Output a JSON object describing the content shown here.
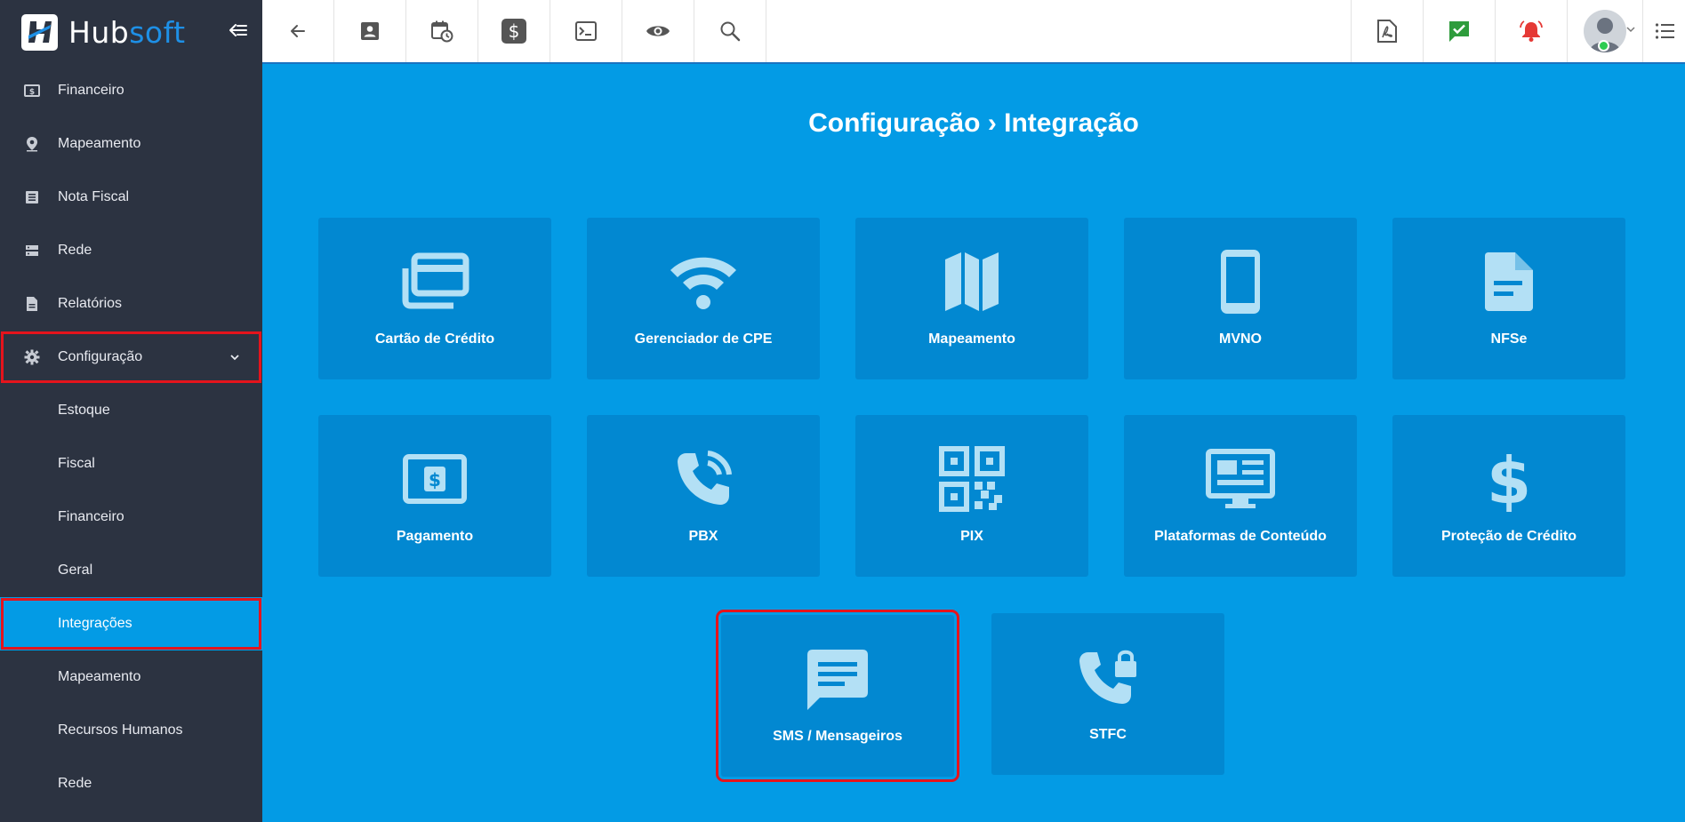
{
  "app": {
    "brand_prefix": "Hub",
    "brand_suffix": "soft"
  },
  "sidebar": {
    "items": [
      {
        "label": "Financeiro",
        "icon": "money-icon"
      },
      {
        "label": "Mapeamento",
        "icon": "map-pin-icon"
      },
      {
        "label": "Nota Fiscal",
        "icon": "receipt-icon"
      },
      {
        "label": "Rede",
        "icon": "server-icon"
      },
      {
        "label": "Relatórios",
        "icon": "document-icon"
      },
      {
        "label": "Configuração",
        "icon": "gear-icon",
        "expanded": true
      },
      {
        "label": "Estoque"
      },
      {
        "label": "Fiscal"
      },
      {
        "label": "Financeiro"
      },
      {
        "label": "Geral"
      },
      {
        "label": "Integrações",
        "active": true
      },
      {
        "label": "Mapeamento"
      },
      {
        "label": "Recursos Humanos"
      },
      {
        "label": "Rede"
      }
    ]
  },
  "topbar": {
    "left_icons": [
      "back-arrow-icon",
      "contact-card-icon",
      "calendar-clock-icon",
      "dollar-icon",
      "terminal-icon",
      "eye-icon",
      "search-icon"
    ],
    "right_icons": [
      "pdf-icon",
      "chat-check-icon",
      "bell-icon",
      "avatar",
      "list-icon"
    ],
    "colors": {
      "chat_check": "#2e9c3c",
      "bell": "#e53935",
      "status_online": "#2ecc52"
    }
  },
  "main": {
    "title": "Configuração › Integração",
    "tiles": [
      {
        "label": "Cartão de Crédito",
        "icon": "credit-cards-icon"
      },
      {
        "label": "Gerenciador de CPE",
        "icon": "wifi-icon"
      },
      {
        "label": "Mapeamento",
        "icon": "map-icon"
      },
      {
        "label": "MVNO",
        "icon": "smartphone-icon"
      },
      {
        "label": "NFSe",
        "icon": "file-icon"
      },
      {
        "label": "Pagamento",
        "icon": "money-bill-icon"
      },
      {
        "label": "PBX",
        "icon": "phone-in-talk-icon"
      },
      {
        "label": "PIX",
        "icon": "qr-code-icon"
      },
      {
        "label": "Plataformas de Conteúdo",
        "icon": "monitor-layout-icon"
      },
      {
        "label": "Proteção de Crédito",
        "icon": "dollar-sign-icon"
      },
      {
        "label": "SMS / Mensageiros",
        "icon": "message-icon"
      },
      {
        "label": "STFC",
        "icon": "phone-lock-icon"
      }
    ]
  },
  "colors": {
    "sidebar_bg": "#2c3341",
    "main_bg": "#039be5",
    "tile_bg": "#0288d1",
    "icon_fill": "#b3e0f5",
    "highlight": "#e5141c"
  }
}
